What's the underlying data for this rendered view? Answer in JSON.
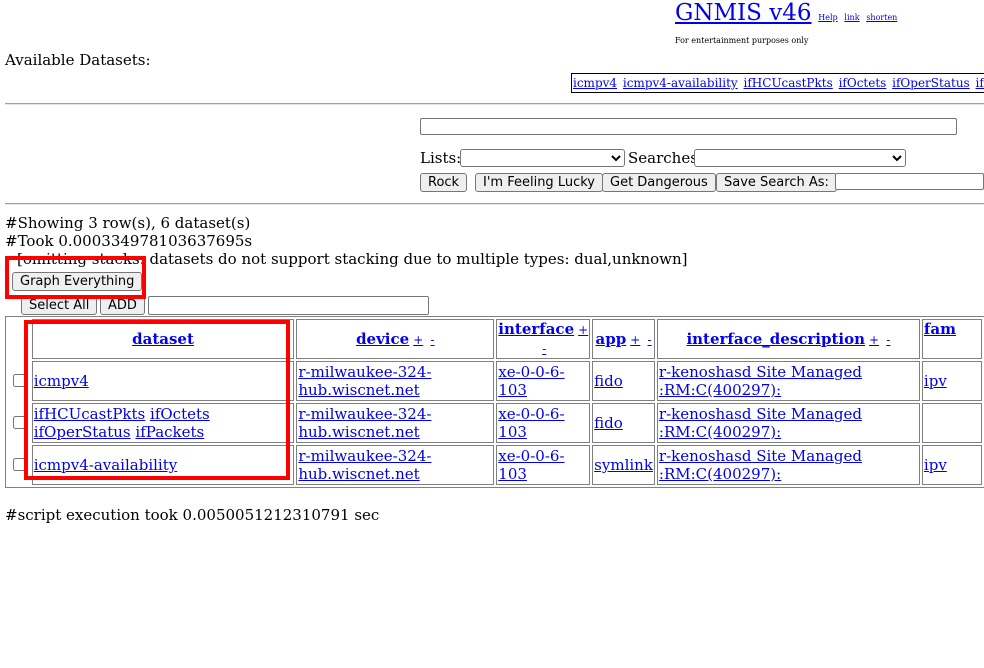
{
  "header": {
    "title": "GNMIS v46",
    "links": [
      "Help",
      "link",
      "shorten"
    ],
    "tagline": "For entertainment purposes only"
  },
  "available_label": "Available Datasets:",
  "dataset_strip": [
    "icmpv4",
    "icmpv4-availability",
    "ifHCUcastPkts",
    "ifOctets",
    "ifOperStatus",
    "ifPackets"
  ],
  "search": {
    "query_value": "",
    "lists_label": "Lists:",
    "lists_selected": "",
    "searches_label": "Searches:",
    "searches_selected": "",
    "buttons": {
      "rock": "Rock",
      "lucky": "I'm Feeling Lucky",
      "dangerous": "Get Dangerous",
      "save": "Save Search As:"
    },
    "save_name_value": ""
  },
  "meta": {
    "showing": "#Showing 3 row(s), 6 dataset(s)",
    "took": "#Took 0.000334978103637695s",
    "stack_note": "[omitting stacks: datasets do not support stacking due to multiple types: dual,unknown]"
  },
  "actions": {
    "graph_everything": "Graph Everything",
    "select_all": "Select All",
    "add": "ADD",
    "add_value": ""
  },
  "table": {
    "columns": {
      "dataset": "dataset",
      "device": "device",
      "interface": "interface",
      "app": "app",
      "interface_description": "interface_description",
      "family": "fam"
    },
    "sort_plus": "+",
    "sort_minus": "-",
    "rows": [
      {
        "checked": false,
        "datasets": [
          "icmpv4"
        ],
        "device": "r-milwaukee-324-hub.wiscnet.net",
        "interface": "xe-0-0-6-103",
        "app": "fido",
        "interface_description": "r-kenoshasd Site Managed :RM:C(400297):",
        "family": "ipv"
      },
      {
        "checked": false,
        "datasets": [
          "ifHCUcastPkts",
          "ifOctets",
          "ifOperStatus",
          "ifPackets"
        ],
        "device": "r-milwaukee-324-hub.wiscnet.net",
        "interface": "xe-0-0-6-103",
        "app": "fido",
        "interface_description": "r-kenoshasd Site Managed :RM:C(400297):",
        "family": ""
      },
      {
        "checked": false,
        "datasets": [
          "icmpv4-availability"
        ],
        "device": "r-milwaukee-324-hub.wiscnet.net",
        "interface": "xe-0-0-6-103",
        "app": "symlink",
        "interface_description": "r-kenoshasd Site Managed :RM:C(400297):",
        "family": "ipv"
      }
    ]
  },
  "footer": "#script execution took 0.0050051212310791 sec",
  "colors": {
    "highlight": "#ff0000",
    "link": "#0000ee"
  }
}
